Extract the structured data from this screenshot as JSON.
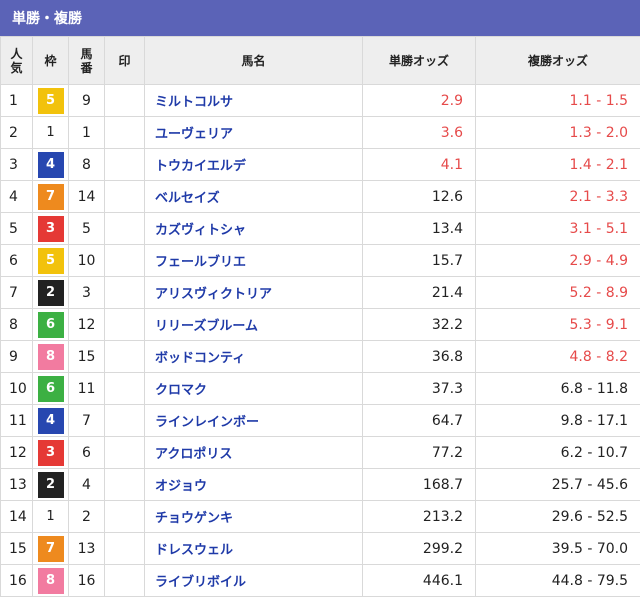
{
  "header": {
    "title": "単勝・複勝"
  },
  "columns": {
    "popularity": [
      "人",
      "気"
    ],
    "waku": "枠",
    "horse_number": [
      "馬",
      "番"
    ],
    "mark": "印",
    "horse_name": "馬名",
    "win_odds": "単勝オッズ",
    "place_odds": "複勝オッズ"
  },
  "rows": [
    {
      "rank": "1",
      "waku": "5",
      "num": "9",
      "name": "ミルトコルサ",
      "win": "2.9",
      "place": "1.1 - 1.5",
      "win_red": true,
      "place_red": true
    },
    {
      "rank": "2",
      "waku": "1",
      "num": "1",
      "name": "ユーヴェリア",
      "win": "3.6",
      "place": "1.3 - 2.0",
      "win_red": true,
      "place_red": true
    },
    {
      "rank": "3",
      "waku": "4",
      "num": "8",
      "name": "トウカイエルデ",
      "win": "4.1",
      "place": "1.4 - 2.1",
      "win_red": true,
      "place_red": true
    },
    {
      "rank": "4",
      "waku": "7",
      "num": "14",
      "name": "ベルセイズ",
      "win": "12.6",
      "place": "2.1 - 3.3",
      "win_red": false,
      "place_red": true
    },
    {
      "rank": "5",
      "waku": "3",
      "num": "5",
      "name": "カズヴィトシャ",
      "win": "13.4",
      "place": "3.1 - 5.1",
      "win_red": false,
      "place_red": true
    },
    {
      "rank": "6",
      "waku": "5",
      "num": "10",
      "name": "フェールブリエ",
      "win": "15.7",
      "place": "2.9 - 4.9",
      "win_red": false,
      "place_red": true
    },
    {
      "rank": "7",
      "waku": "2",
      "num": "3",
      "name": "アリスヴィクトリア",
      "win": "21.4",
      "place": "5.2 - 8.9",
      "win_red": false,
      "place_red": true
    },
    {
      "rank": "8",
      "waku": "6",
      "num": "12",
      "name": "リリーズブルーム",
      "win": "32.2",
      "place": "5.3 - 9.1",
      "win_red": false,
      "place_red": true
    },
    {
      "rank": "9",
      "waku": "8",
      "num": "15",
      "name": "ボッドコンティ",
      "win": "36.8",
      "place": "4.8 - 8.2",
      "win_red": false,
      "place_red": true
    },
    {
      "rank": "10",
      "waku": "6",
      "num": "11",
      "name": "クロマク",
      "win": "37.3",
      "place": "6.8 - 11.8",
      "win_red": false,
      "place_red": false
    },
    {
      "rank": "11",
      "waku": "4",
      "num": "7",
      "name": "ラインレインボー",
      "win": "64.7",
      "place": "9.8 - 17.1",
      "win_red": false,
      "place_red": false
    },
    {
      "rank": "12",
      "waku": "3",
      "num": "6",
      "name": "アクロポリス",
      "win": "77.2",
      "place": "6.2 - 10.7",
      "win_red": false,
      "place_red": false
    },
    {
      "rank": "13",
      "waku": "2",
      "num": "4",
      "name": "オジョウ",
      "win": "168.7",
      "place": "25.7 - 45.6",
      "win_red": false,
      "place_red": false
    },
    {
      "rank": "14",
      "waku": "1",
      "num": "2",
      "name": "チョウゲンキ",
      "win": "213.2",
      "place": "29.6 - 52.5",
      "win_red": false,
      "place_red": false
    },
    {
      "rank": "15",
      "waku": "7",
      "num": "13",
      "name": "ドレスウェル",
      "win": "299.2",
      "place": "39.5 - 70.0",
      "win_red": false,
      "place_red": false
    },
    {
      "rank": "16",
      "waku": "8",
      "num": "16",
      "name": "ライブリボイル",
      "win": "446.1",
      "place": "44.8 - 79.5",
      "win_red": false,
      "place_red": false
    }
  ]
}
